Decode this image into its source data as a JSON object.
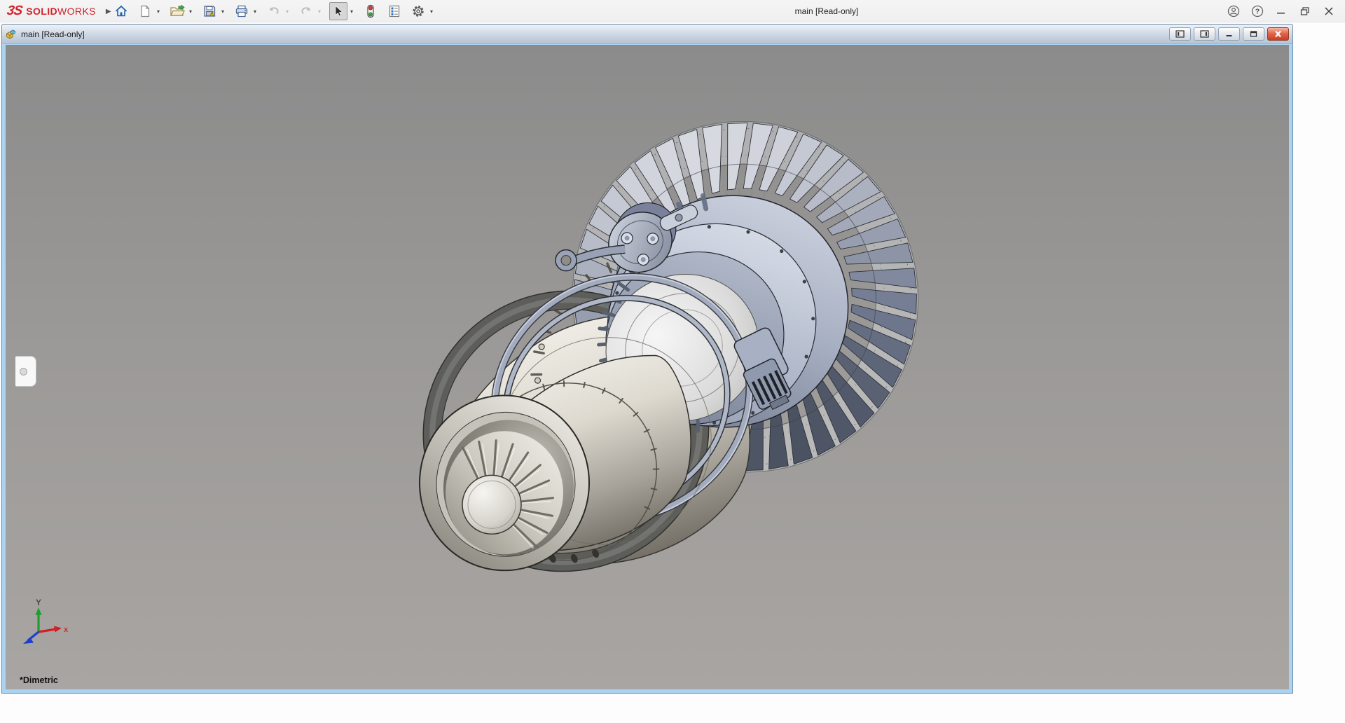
{
  "app": {
    "title": "main [Read-only]",
    "brand": {
      "mark": "3S",
      "name_bold": "SOLID",
      "name_light": "WORKS",
      "color": "#d1232a"
    },
    "toolbar_icons": [
      "home",
      "new-document",
      "open",
      "save",
      "print",
      "undo",
      "redo",
      "select-cursor",
      "rebuild-traffic-light",
      "file-properties",
      "options-gear"
    ],
    "window_icons": [
      "user-account",
      "help",
      "minimize",
      "restore",
      "close"
    ],
    "help_glyph": "?"
  },
  "document": {
    "title": "main [Read-only]",
    "titlebar_icons": [
      "assembly",
      "show-left-pane",
      "show-right-pane",
      "minimize",
      "restore",
      "close"
    ]
  },
  "viewport": {
    "view_label": "*Dimetric",
    "triad": {
      "x_label": "x",
      "y_label": "Y"
    },
    "background_top": "#8b8b8b",
    "background_bottom": "#a8a5a2"
  },
  "colors": {
    "doc_border_blue": "#a9d3f1",
    "close_button_red": "#c63f22",
    "brand_red": "#d1232a"
  }
}
